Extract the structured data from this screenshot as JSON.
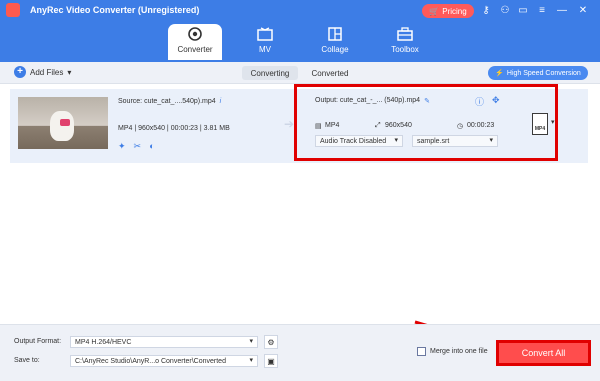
{
  "app": {
    "title": "AnyRec Video Converter (Unregistered)",
    "pricing_label": "Pricing"
  },
  "nav": {
    "tabs": [
      {
        "label": "Converter",
        "icon": "converter-icon",
        "active": true
      },
      {
        "label": "MV",
        "icon": "mv-icon",
        "active": false
      },
      {
        "label": "Collage",
        "icon": "collage-icon",
        "active": false
      },
      {
        "label": "Toolbox",
        "icon": "toolbox-icon",
        "active": false
      }
    ]
  },
  "toolbar": {
    "add_files_label": "Add Files",
    "converting_label": "Converting",
    "converted_label": "Converted",
    "high_speed_label": "High Speed Conversion"
  },
  "file": {
    "source_name": "Source: cute_cat_....540p).mp4",
    "source_format": "MP4",
    "source_resolution": "960x540",
    "source_duration": "00:00:23",
    "source_size": "3.81 MB",
    "output_name": "Output: cute_cat_-_... (540p).mp4",
    "output_format": "MP4",
    "output_resolution": "960x540",
    "output_duration": "00:00:23",
    "audio_track": "Audio Track Disabled",
    "subtitle": "sample.srt",
    "format_badge": "MP4"
  },
  "bottom": {
    "output_format_label": "Output Format:",
    "output_format_value": "MP4 H.264/HEVC",
    "save_to_label": "Save to:",
    "save_to_value": "C:\\AnyRec Studio\\AnyR...o Converter\\Converted",
    "merge_label": "Merge into one file",
    "convert_all_label": "Convert All"
  },
  "colors": {
    "brand_blue": "#3d7de6",
    "highlight_red": "#e00000",
    "convert_button": "#ff4d4d"
  }
}
